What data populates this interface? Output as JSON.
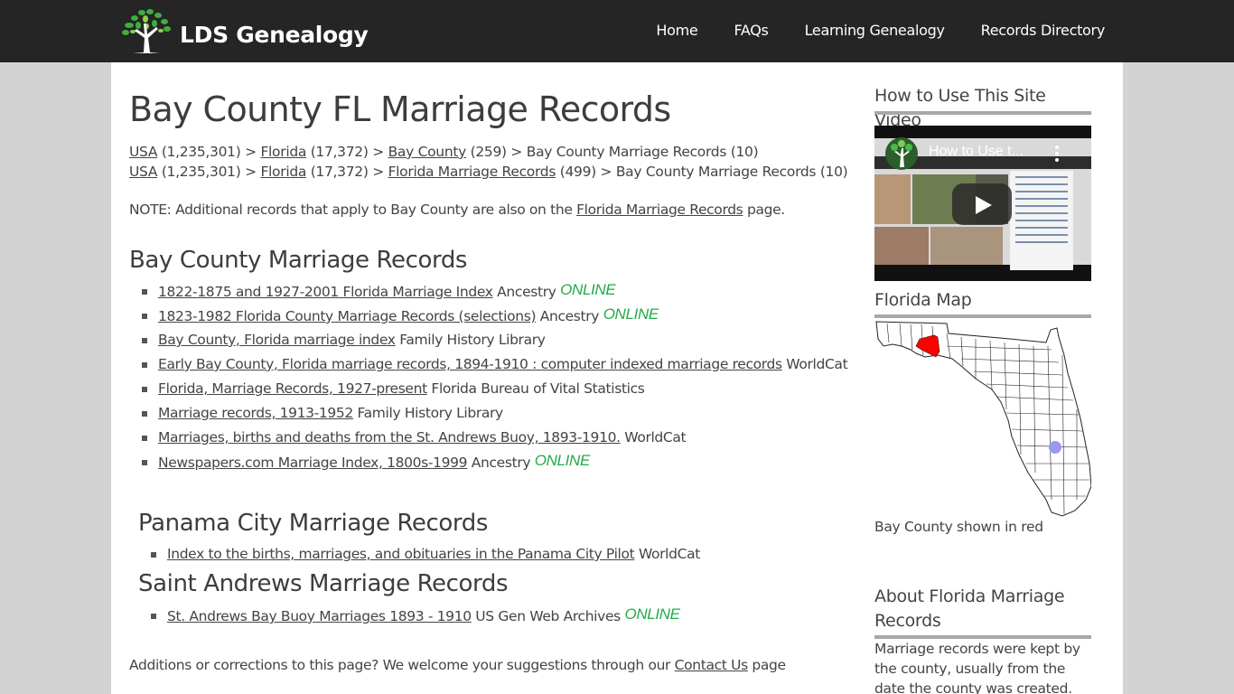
{
  "header": {
    "logo_text": "LDS Genealogy",
    "nav": [
      {
        "label": "Home"
      },
      {
        "label": "FAQs"
      },
      {
        "label": "Learning Genealogy"
      },
      {
        "label": "Records Directory"
      }
    ]
  },
  "page": {
    "title": "Bay County FL Marriage Records",
    "breadcrumbs": [
      {
        "usa": "USA",
        "usa_count": " (1,235,301) > ",
        "state": "Florida",
        "state_count": " (17,372) > ",
        "mid": "Bay County",
        "mid_count": " (259) > ",
        "current": "Bay County Marriage Records (10)"
      },
      {
        "usa": "USA",
        "usa_count": " (1,235,301) > ",
        "state": "Florida",
        "state_count": " (17,372) > ",
        "mid": "Florida Marriage Records",
        "mid_count": " (499) > ",
        "current": "Bay County Marriage Records (10)"
      }
    ],
    "note": {
      "prefix": "NOTE: Additional records that apply to Bay County are also on the ",
      "link": "Florida Marriage Records",
      "suffix": " page."
    },
    "sections": [
      {
        "title": "Bay County Marriage Records",
        "items": [
          {
            "link": "1822-1875 and 1927-2001 Florida Marriage Index",
            "source": " Ancestry ",
            "online": "ONLINE"
          },
          {
            "link": "1823-1982 Florida County Marriage Records (selections)",
            "source": " Ancestry ",
            "online": "ONLINE"
          },
          {
            "link": "Bay County, Florida marriage index",
            "source": " Family History Library",
            "online": ""
          },
          {
            "link": "Early Bay County, Florida marriage records, 1894-1910 : computer indexed marriage records",
            "source": " WorldCat",
            "online": ""
          },
          {
            "link": "Florida, Marriage Records, 1927-present",
            "source": " Florida Bureau of Vital Statistics",
            "online": ""
          },
          {
            "link": "Marriage records, 1913-1952",
            "source": " Family History Library",
            "online": ""
          },
          {
            "link": "Marriages, births and deaths from the St. Andrews Buoy, 1893-1910.",
            "source": " WorldCat",
            "online": ""
          },
          {
            "link": "Newspapers.com Marriage Index, 1800s-1999",
            "source": " Ancestry ",
            "online": "ONLINE"
          }
        ]
      },
      {
        "title": "Panama City Marriage Records",
        "items": [
          {
            "link": "Index to the births, marriages, and obituaries in the Panama City Pilot",
            "source": " WorldCat",
            "online": ""
          }
        ]
      },
      {
        "title": "Saint Andrews Marriage Records",
        "items": [
          {
            "link": "St. Andrews Bay Buoy Marriages 1893 - 1910",
            "source": " US Gen Web Archives ",
            "online": "ONLINE"
          }
        ]
      }
    ],
    "footer_note": {
      "prefix": "Additions or corrections to this page? We welcome your suggestions through our ",
      "link": "Contact Us",
      "suffix": " page"
    }
  },
  "sidebar": {
    "video": {
      "title": "How to Use This Site Video",
      "video_title": "How to Use t..."
    },
    "map": {
      "title": "Florida Map",
      "caption": "Bay County shown in red",
      "highlight_color": "#ff0000"
    },
    "about": {
      "title": "About Florida Marriage Records",
      "text": "Marriage records were kept by the county, usually from the date the county was created."
    }
  },
  "colors": {
    "header_bg": "#252525",
    "page_bg": "#d3d3d3",
    "online_green": "#22aa4a",
    "text": "#444444"
  }
}
